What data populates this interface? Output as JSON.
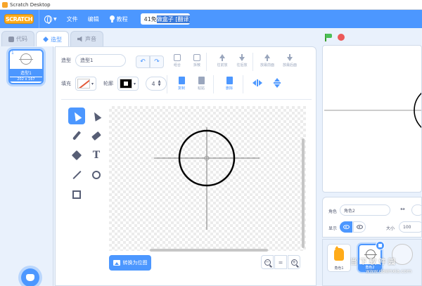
{
  "window": {
    "title": "Scratch Desktop"
  },
  "menubar": {
    "logo": "SCRATCH",
    "file": "文件",
    "edit": "编辑",
    "tutorials": "教程",
    "project_title_prefix": "41免",
    "project_title_highlight": "做盒子 [翻译]"
  },
  "tabs": [
    {
      "label": "代码"
    },
    {
      "label": "造型"
    },
    {
      "label": "声音"
    }
  ],
  "costumes": [
    {
      "index": "1",
      "name": "造型1",
      "size": "202 x 167"
    }
  ],
  "paint_editor": {
    "costume_label": "造型",
    "costume_name": "造型1",
    "undo_icon": "↶",
    "redo_icon": "↷",
    "group": "组合",
    "ungroup": "拆散",
    "forward": "往前放",
    "backward": "往后放",
    "front": "放最前面",
    "back": "放最后面",
    "fill_label": "填充",
    "outline_label": "轮廓",
    "outline_width": "4",
    "copy": "复制",
    "paste": "粘贴",
    "delete": "删除",
    "convert_bitmap": "转换为位图",
    "zoom_reset": "="
  },
  "stage_panel": {
    "sprite_label": "角色",
    "sprite_name": "角色2",
    "x_arrows": "↔",
    "show_label": "显示",
    "size_label": "大小",
    "size_value": "100"
  },
  "sprites": [
    {
      "name": "角色1"
    },
    {
      "name": "角色2"
    }
  ],
  "watermark": {
    "text": "当 下 软 件 园",
    "url": "www.downxia.com"
  }
}
